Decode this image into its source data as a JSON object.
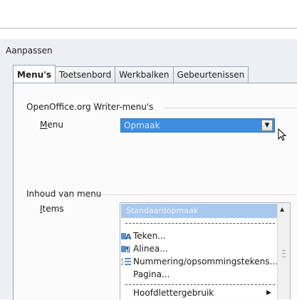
{
  "window": {
    "title": "Aanpassen"
  },
  "tabs": [
    {
      "label": "Menu's",
      "active": true
    },
    {
      "label": "Toetsenbord",
      "active": false
    },
    {
      "label": "Werkbalken",
      "active": false
    },
    {
      "label": "Gebeurtenissen",
      "active": false
    }
  ],
  "menus_group": {
    "title": "OpenOffice.org Writer-menu's",
    "menu_label_prefix": "M",
    "menu_label_rest": "enu",
    "menu_value": "Opmaak"
  },
  "content_group": {
    "title": "Inhoud van menu",
    "items_label_prefix": "I",
    "items_label_rest": "tems",
    "list": {
      "header": "Standaardopmaak",
      "items": [
        {
          "label": "Teken...",
          "icon": "character-icon"
        },
        {
          "label": "Alinea...",
          "icon": "paragraph-icon"
        },
        {
          "label": "Nummering/opsommingstekens...",
          "icon": "numbering-icon"
        },
        {
          "label": "Pagina...",
          "icon": null
        },
        {
          "label": "Hoofdlettergebruik",
          "icon": null,
          "submenu": true
        }
      ]
    }
  },
  "colors": {
    "selection": "#3d8ee0",
    "list_header": "#a9c8ee",
    "dialog_bg": "#eceff3"
  }
}
